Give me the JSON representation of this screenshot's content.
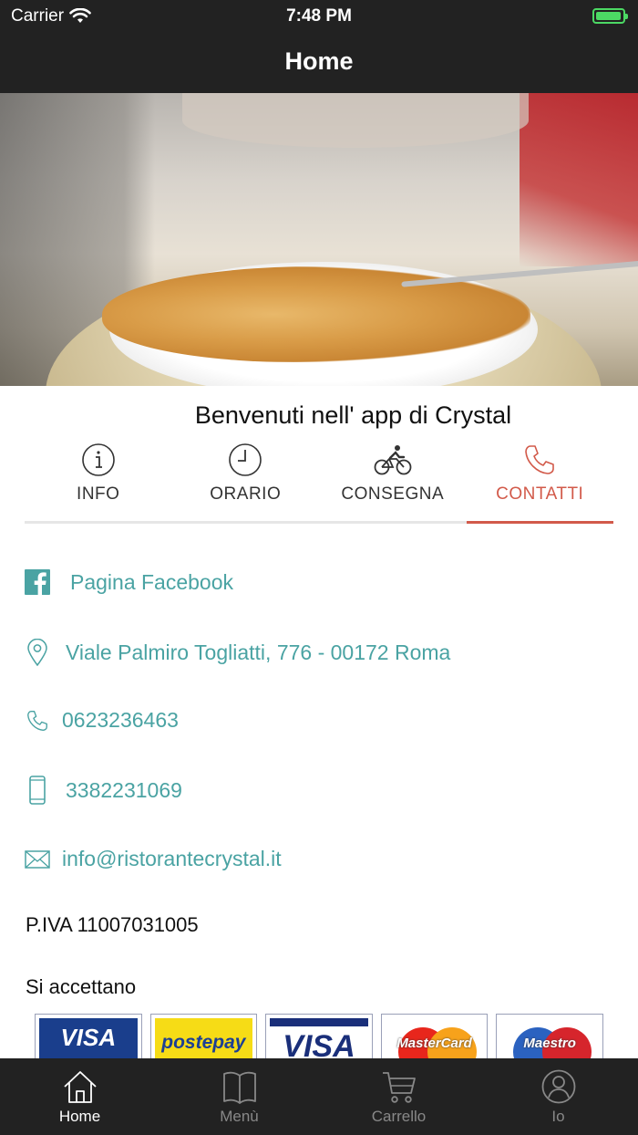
{
  "status_bar": {
    "carrier": "Carrier",
    "time": "7:48 PM"
  },
  "nav": {
    "title": "Home"
  },
  "carousel": {
    "slide_count": 4,
    "active_index": 2,
    "active_color": "#1677e6"
  },
  "welcome": "Benvenuti nell' app di Crystal",
  "tabs": [
    {
      "label": "INFO",
      "icon": "info-icon"
    },
    {
      "label": "ORARIO",
      "icon": "clock-icon"
    },
    {
      "label": "CONSEGNA",
      "icon": "bicycle-icon"
    },
    {
      "label": "CONTATTI",
      "icon": "phone-icon",
      "active": true
    }
  ],
  "accent_color": "#d25a4a",
  "link_color": "#4aa3a3",
  "contacts": {
    "facebook": "Pagina Facebook",
    "address": "Viale Palmiro Togliatti, 776 - 00172 Roma",
    "phone": "0623236463",
    "mobile": "3382231069",
    "email": "info@ristorantecrystal.it"
  },
  "piva": "P.IVA 11007031005",
  "payments": {
    "heading": "Si accettano",
    "cards": [
      "VISA",
      "postepay",
      "VISA",
      "MasterCard",
      "Maestro"
    ]
  },
  "bottom_nav": [
    {
      "label": "Home",
      "icon": "home-icon",
      "active": true
    },
    {
      "label": "Menù",
      "icon": "book-icon"
    },
    {
      "label": "Carrello",
      "icon": "cart-icon"
    },
    {
      "label": "Io",
      "icon": "user-icon"
    }
  ]
}
